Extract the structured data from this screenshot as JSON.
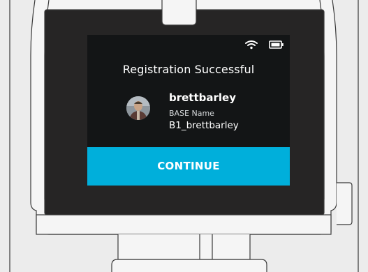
{
  "screen": {
    "title": "Registration Successful",
    "user": {
      "username": "brettbarley",
      "base_label": "BASE Name",
      "base_name": "B1_brettbarley"
    },
    "continue_label": "CONTINUE"
  },
  "status_bar": {
    "icons": [
      "wifi-icon",
      "battery-icon"
    ]
  },
  "colors": {
    "accent": "#00afdb",
    "screen_bg": "#131516",
    "bezel": "#262525",
    "device_body": "#f5f5f5",
    "outline": "#3a3a3a"
  }
}
